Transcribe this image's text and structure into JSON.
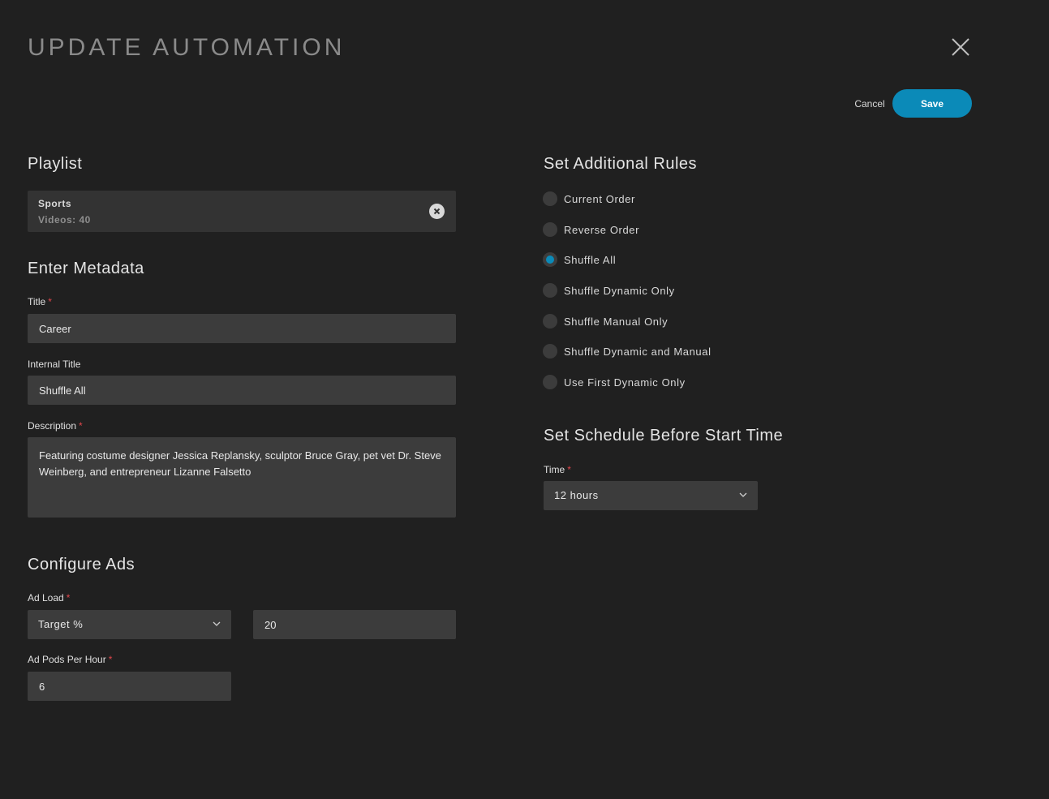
{
  "header": {
    "title": "UPDATE AUTOMATION",
    "cancel_label": "Cancel",
    "save_label": "Save"
  },
  "playlist": {
    "section_title": "Playlist",
    "name": "Sports",
    "count": "Videos: 40"
  },
  "metadata": {
    "section_title": "Enter Metadata",
    "title_label": "Title",
    "title_value": "Career",
    "internal_title_label": "Internal Title",
    "internal_title_value": "Shuffle All",
    "description_label": "Description",
    "description_value": "Featuring costume designer Jessica Replansky, sculptor Bruce Gray, pet vet Dr. Steve Weinberg, and entrepreneur Lizanne Falsetto",
    "required_marker": "*"
  },
  "ads": {
    "section_title": "Configure Ads",
    "ad_load_label": "Ad Load",
    "ad_load_type": "Target %",
    "ad_load_value": "20",
    "ad_pods_label": "Ad Pods Per Hour",
    "ad_pods_value": "6"
  },
  "rules": {
    "section_title": "Set Additional Rules",
    "selected": "Shuffle All",
    "options": [
      "Current Order",
      "Reverse Order",
      "Shuffle All",
      "Shuffle Dynamic Only",
      "Shuffle Manual Only",
      "Shuffle Dynamic and Manual",
      "Use First Dynamic Only"
    ]
  },
  "schedule": {
    "section_title": "Set Schedule Before Start Time",
    "time_label": "Time",
    "time_value": "12 hours"
  },
  "colors": {
    "background": "#202020",
    "accent": "#0b8ab8",
    "input_bg": "#3c3c3c",
    "required": "#e0464b"
  }
}
